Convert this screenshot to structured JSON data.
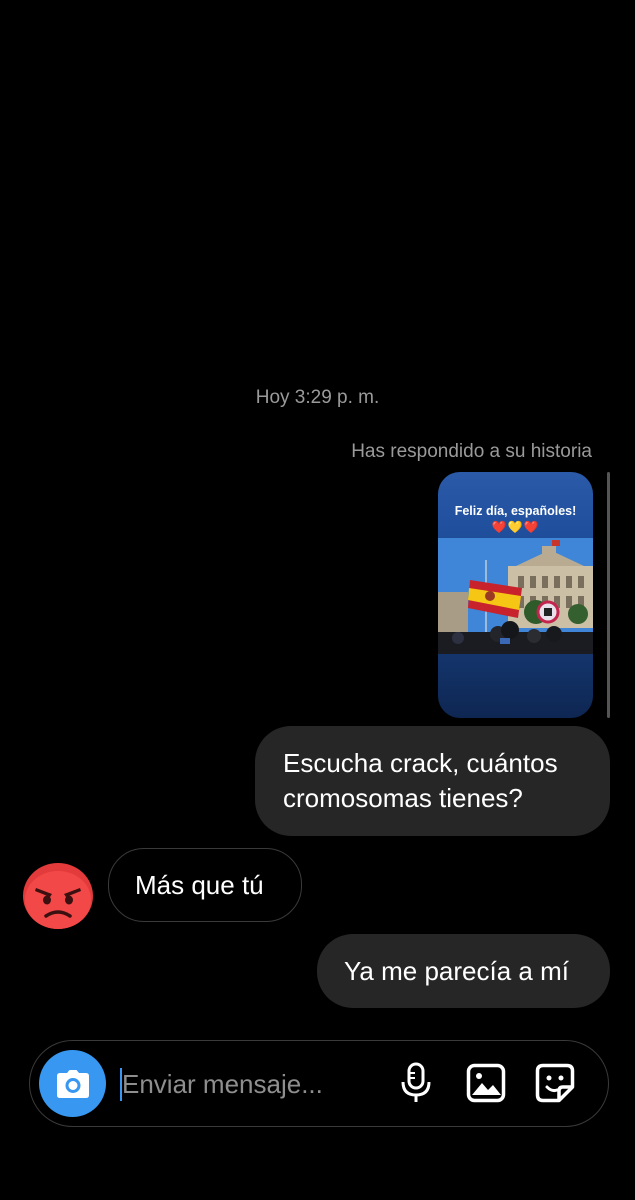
{
  "conversation": {
    "timestamp": "Hoy 3:29 p. m.",
    "story_reply_note": "Has respondido a su historia",
    "story": {
      "caption": "Feliz día, españoles!",
      "hearts": "❤️💛❤️"
    },
    "messages": [
      {
        "direction": "sent",
        "text": "Escucha crack, cuántos cromosomas tienes?"
      },
      {
        "direction": "received",
        "text": "Más que tú"
      },
      {
        "direction": "sent",
        "text": "Ya me parecía a mí"
      }
    ],
    "avatar_emoji": "angry-face"
  },
  "composer": {
    "placeholder": "Enviar mensaje...",
    "value": "",
    "icons": [
      "camera-icon",
      "microphone-icon",
      "gallery-icon",
      "sticker-icon"
    ]
  },
  "colors": {
    "background": "#000000",
    "sent_bubble": "#262626",
    "received_border": "#3a3a3a",
    "accent": "#3897f0",
    "meta_text": "#9a9a9a"
  }
}
